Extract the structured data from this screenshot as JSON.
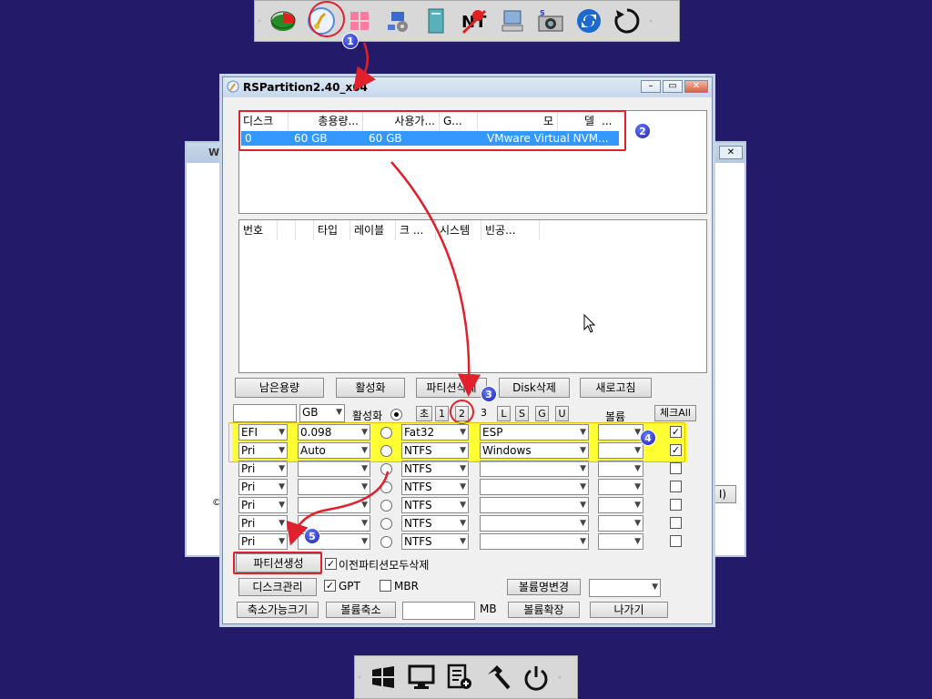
{
  "top_toolbar": {
    "icons": [
      "disk-pie-icon",
      "partition-tool-icon",
      "windows-tiles-icon",
      "network-settings-icon",
      "book-icon",
      "no-t-icon",
      "pc-icon",
      "screenshot-camera-icon",
      "refresh-icon",
      "restart-icon"
    ]
  },
  "background_window": {
    "title": "Wi"
  },
  "window": {
    "title": "RSPartition2.40_x64",
    "disk_list": {
      "headers": [
        "디스크",
        "총용량...",
        "사용가...",
        "G...",
        "모",
        "델",
        "..."
      ],
      "rows": [
        [
          "0",
          "60 GB",
          "60 GB",
          "",
          "VMware Virtual NVM..."
        ]
      ]
    },
    "partition_list": {
      "headers": [
        "번호",
        "",
        "",
        "타입",
        "레이블",
        "크 ...",
        "시스템",
        "빈공..."
      ]
    },
    "buttons": {
      "remaining": "남은용량",
      "activate": "활성화",
      "delete_partition": "파티션삭제",
      "delete_disk": "Disk삭제",
      "refresh": "새로고침"
    },
    "unit_select": "GB",
    "active_label": "활성화",
    "preset_buttons": [
      "초",
      "1",
      "2",
      "3",
      "L",
      "S",
      "G",
      "U"
    ],
    "volume_label": "볼륨",
    "check_all": "체크All",
    "partition_rows": [
      {
        "type": "EFI",
        "size": "0.098",
        "active": false,
        "fs": "Fat32",
        "label": "ESP",
        "volume": "",
        "checked": true
      },
      {
        "type": "Pri",
        "size": "Auto",
        "active": false,
        "fs": "NTFS",
        "label": "Windows",
        "volume": "",
        "checked": true
      },
      {
        "type": "Pri",
        "size": "",
        "active": false,
        "fs": "NTFS",
        "label": "",
        "volume": "",
        "checked": false
      },
      {
        "type": "Pri",
        "size": "",
        "active": false,
        "fs": "NTFS",
        "label": "",
        "volume": "",
        "checked": false
      },
      {
        "type": "Pri",
        "size": "",
        "active": false,
        "fs": "NTFS",
        "label": "",
        "volume": "",
        "checked": false
      },
      {
        "type": "Pri",
        "size": "",
        "active": false,
        "fs": "NTFS",
        "label": "",
        "volume": "",
        "checked": false
      },
      {
        "type": "Pri",
        "size": "",
        "active": false,
        "fs": "NTFS",
        "label": "",
        "volume": "",
        "checked": false
      }
    ],
    "create_partition": "파티션생성",
    "delete_prev_partitions": "이전파티션모두삭제",
    "disk_management": "디스크관리",
    "gpt": "GPT",
    "mbr": "MBR",
    "volume_rename": "볼륨명변경",
    "shrinkable_size": "축소가능크기",
    "volume_shrink": "볼륨축소",
    "mb_label": "MB",
    "volume_extend": "볼륨확장",
    "exit": "나가기",
    "bg_button_fragment": "I)"
  },
  "annotations": [
    "1",
    "2",
    "3",
    "4",
    "5"
  ],
  "bottom_toolbar": {
    "icons": [
      "windows-flag-icon",
      "computer-icon",
      "document-list-icon",
      "hammer-icon",
      "power-icon"
    ]
  },
  "colors": {
    "desktop": "#241a6a",
    "highlight": "#ffff33",
    "annotation_red": "#e0202a",
    "selection": "#3399ff"
  }
}
